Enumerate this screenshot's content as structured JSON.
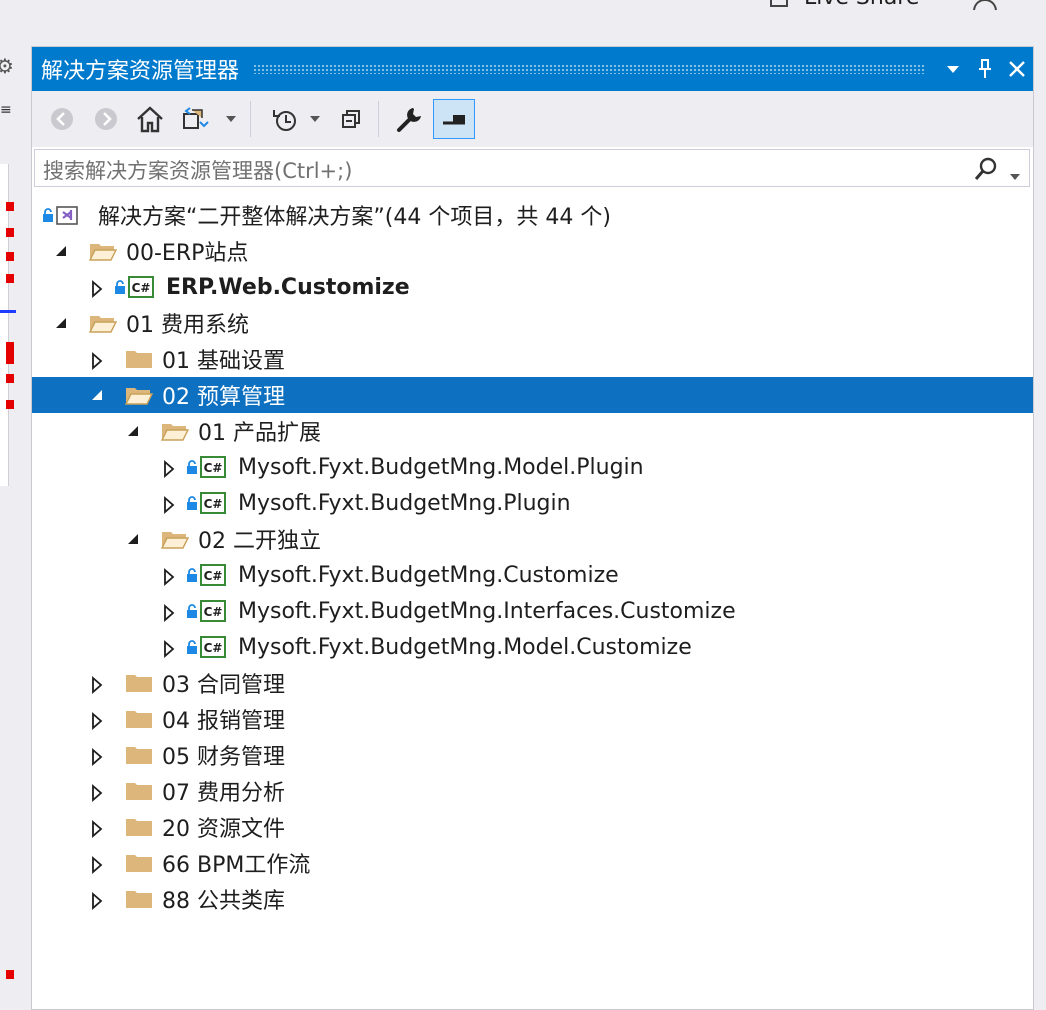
{
  "top": {
    "live_share_label": "Live Share"
  },
  "panel": {
    "title": "解决方案资源管理器",
    "search_placeholder": "搜索解决方案资源管理器(Ctrl+;)"
  },
  "tree": {
    "solution": "解决方案“二开整体解决方案”(44 个项目，共 44 个)",
    "rows": [
      {
        "text": "00-ERP站点"
      },
      {
        "text": "ERP.Web.Customize"
      },
      {
        "text": "01 费用系统"
      },
      {
        "text": "01 基础设置"
      },
      {
        "text": "02 预算管理"
      },
      {
        "text": "01 产品扩展"
      },
      {
        "text": "Mysoft.Fyxt.BudgetMng.Model.Plugin"
      },
      {
        "text": "Mysoft.Fyxt.BudgetMng.Plugin"
      },
      {
        "text": "02 二开独立"
      },
      {
        "text": "Mysoft.Fyxt.BudgetMng.Customize"
      },
      {
        "text": "Mysoft.Fyxt.BudgetMng.Interfaces.Customize"
      },
      {
        "text": "Mysoft.Fyxt.BudgetMng.Model.Customize"
      },
      {
        "text": "03 合同管理"
      },
      {
        "text": "04 报销管理"
      },
      {
        "text": "05 财务管理"
      },
      {
        "text": "07 费用分析"
      },
      {
        "text": "20 资源文件"
      },
      {
        "text": "66 BPM工作流"
      },
      {
        "text": "88 公共类库"
      }
    ]
  },
  "colors": {
    "accent": "#007acc",
    "selection": "#0e70c0",
    "folder": "#dcb67a",
    "csharp": "#388a34",
    "lock": "#1e88e5"
  },
  "icons": [
    "back-icon",
    "forward-icon",
    "home-icon",
    "sync-icon",
    "history-icon",
    "collapse-all-icon",
    "properties-wrench-icon",
    "preview-icon",
    "search-icon",
    "pin-icon",
    "close-icon",
    "folder-icon",
    "csharp-project-icon",
    "lock-icon",
    "solution-icon"
  ]
}
